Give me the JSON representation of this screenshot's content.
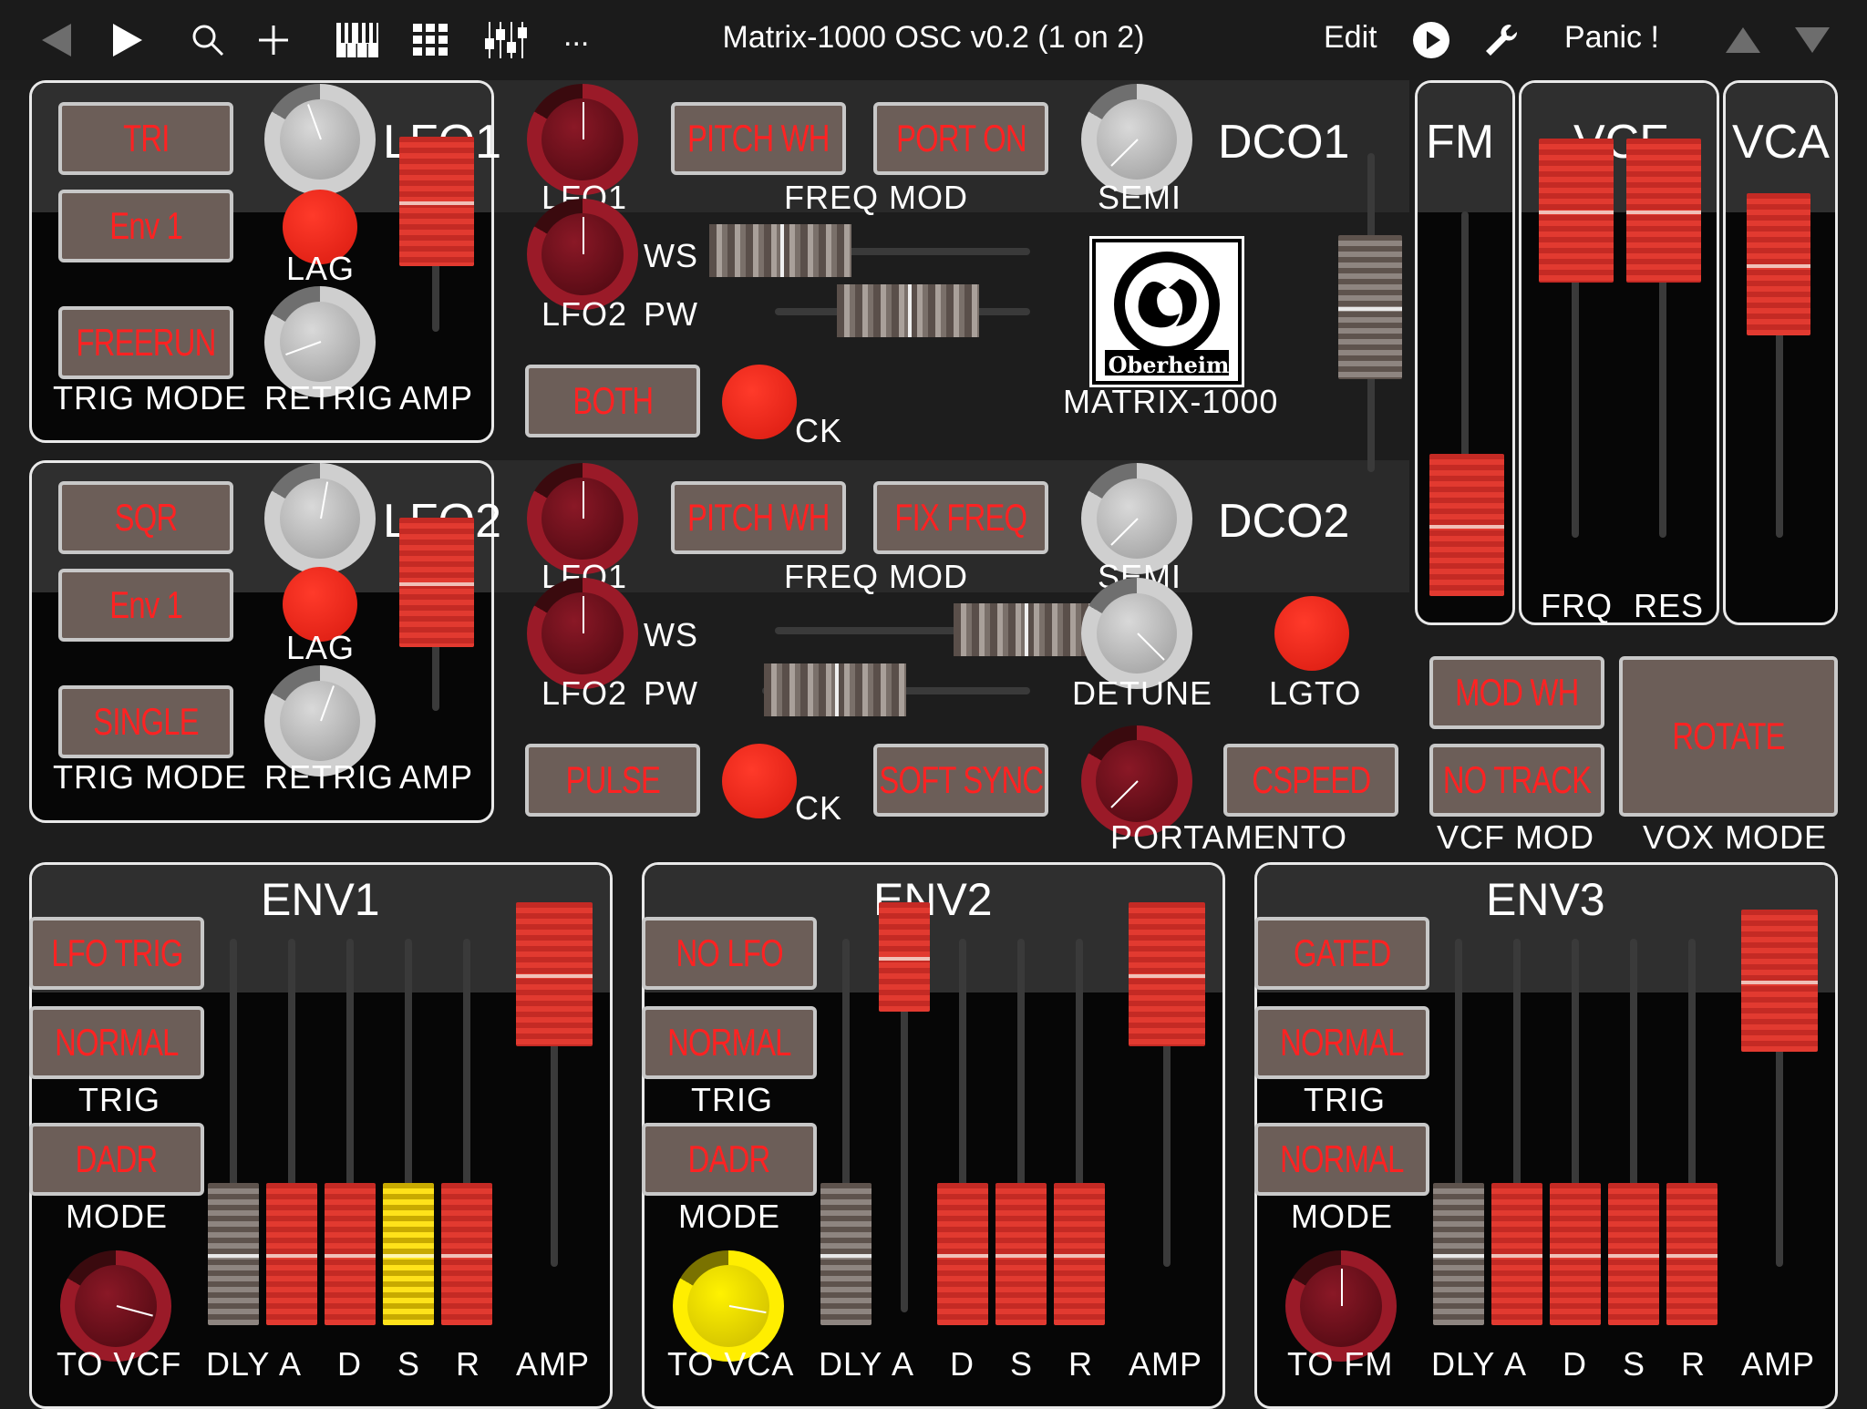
{
  "topbar": {
    "title": "Matrix-1000 OSC v0.2  (1 on 2)",
    "edit": "Edit",
    "panic": "Panic !",
    "more": "..."
  },
  "lfo1": {
    "name": "LFO1",
    "wave": "TRI",
    "trig_source": "Env 1",
    "trig_mode": "FREERUN",
    "lag": "LAG",
    "trig_mode_label": "TRIG MODE",
    "retrig": "RETRIG",
    "amp": "AMP"
  },
  "lfo2": {
    "name": "LFO2",
    "wave": "SQR",
    "trig_source": "Env 1",
    "trig_mode": "SINGLE",
    "lag": "LAG",
    "trig_mode_label": "TRIG MODE",
    "retrig": "RETRIG",
    "amp": "AMP"
  },
  "dco1": {
    "name": "DCO1",
    "lfo1": "LFO1",
    "lfo2": "LFO2",
    "ws": "WS",
    "pw": "PW",
    "freq_mod": "FREQ MOD",
    "pitch": "PITCH WH",
    "port": "PORT ON",
    "semi": "SEMI",
    "wave": "BOTH",
    "ck": "CK"
  },
  "dco2": {
    "name": "DCO2",
    "lfo1": "LFO1",
    "lfo2": "LFO2",
    "ws": "WS",
    "pw": "PW",
    "freq_mod": "FREQ MOD",
    "pitch": "PITCH WH",
    "fix": "FIX FREQ",
    "semi": "SEMI",
    "wave": "PULSE",
    "ck": "CK",
    "detune": "DETUNE",
    "lgto": "LGTO",
    "sync": "SOFT SYNC",
    "cspeed": "CSPEED",
    "portamento": "PORTAMENTO"
  },
  "logo": {
    "brand": "Oberheim",
    "model": "MATRIX-1000"
  },
  "fm": {
    "name": "FM"
  },
  "vcf": {
    "name": "VCF",
    "frq": "FRQ",
    "res": "RES",
    "mod_wh": "MOD WH",
    "no_track": "NO TRACK",
    "vcf_mod": "VCF MOD"
  },
  "vca": {
    "name": "VCA"
  },
  "vox": {
    "mode": "ROTATE",
    "label": "VOX MODE"
  },
  "env1": {
    "name": "ENV1",
    "lfo": "LFO TRIG",
    "trig": "NORMAL",
    "trig_label": "TRIG",
    "mode": "DADR",
    "mode_label": "MODE",
    "to": "TO VCF",
    "dly": "DLY",
    "a": "A",
    "d": "D",
    "s": "S",
    "r": "R",
    "amp": "AMP"
  },
  "env2": {
    "name": "ENV2",
    "lfo": "NO LFO",
    "trig": "NORMAL",
    "trig_label": "TRIG",
    "mode": "DADR",
    "mode_label": "MODE",
    "to": "TO VCA",
    "dly": "DLY",
    "a": "A",
    "d": "D",
    "s": "S",
    "r": "R",
    "amp": "AMP"
  },
  "env3": {
    "name": "ENV3",
    "lfo": "GATED",
    "trig": "NORMAL",
    "trig_label": "TRIG",
    "mode": "NORMAL",
    "mode_label": "MODE",
    "to": "TO FM",
    "dly": "DLY",
    "a": "A",
    "d": "D",
    "s": "S",
    "r": "R",
    "amp": "AMP"
  },
  "colors": {
    "accent": "#e8322a",
    "button_bg": "#6c5e58",
    "button_text": "#ff2222",
    "panel_border": "#e9e9e9"
  }
}
